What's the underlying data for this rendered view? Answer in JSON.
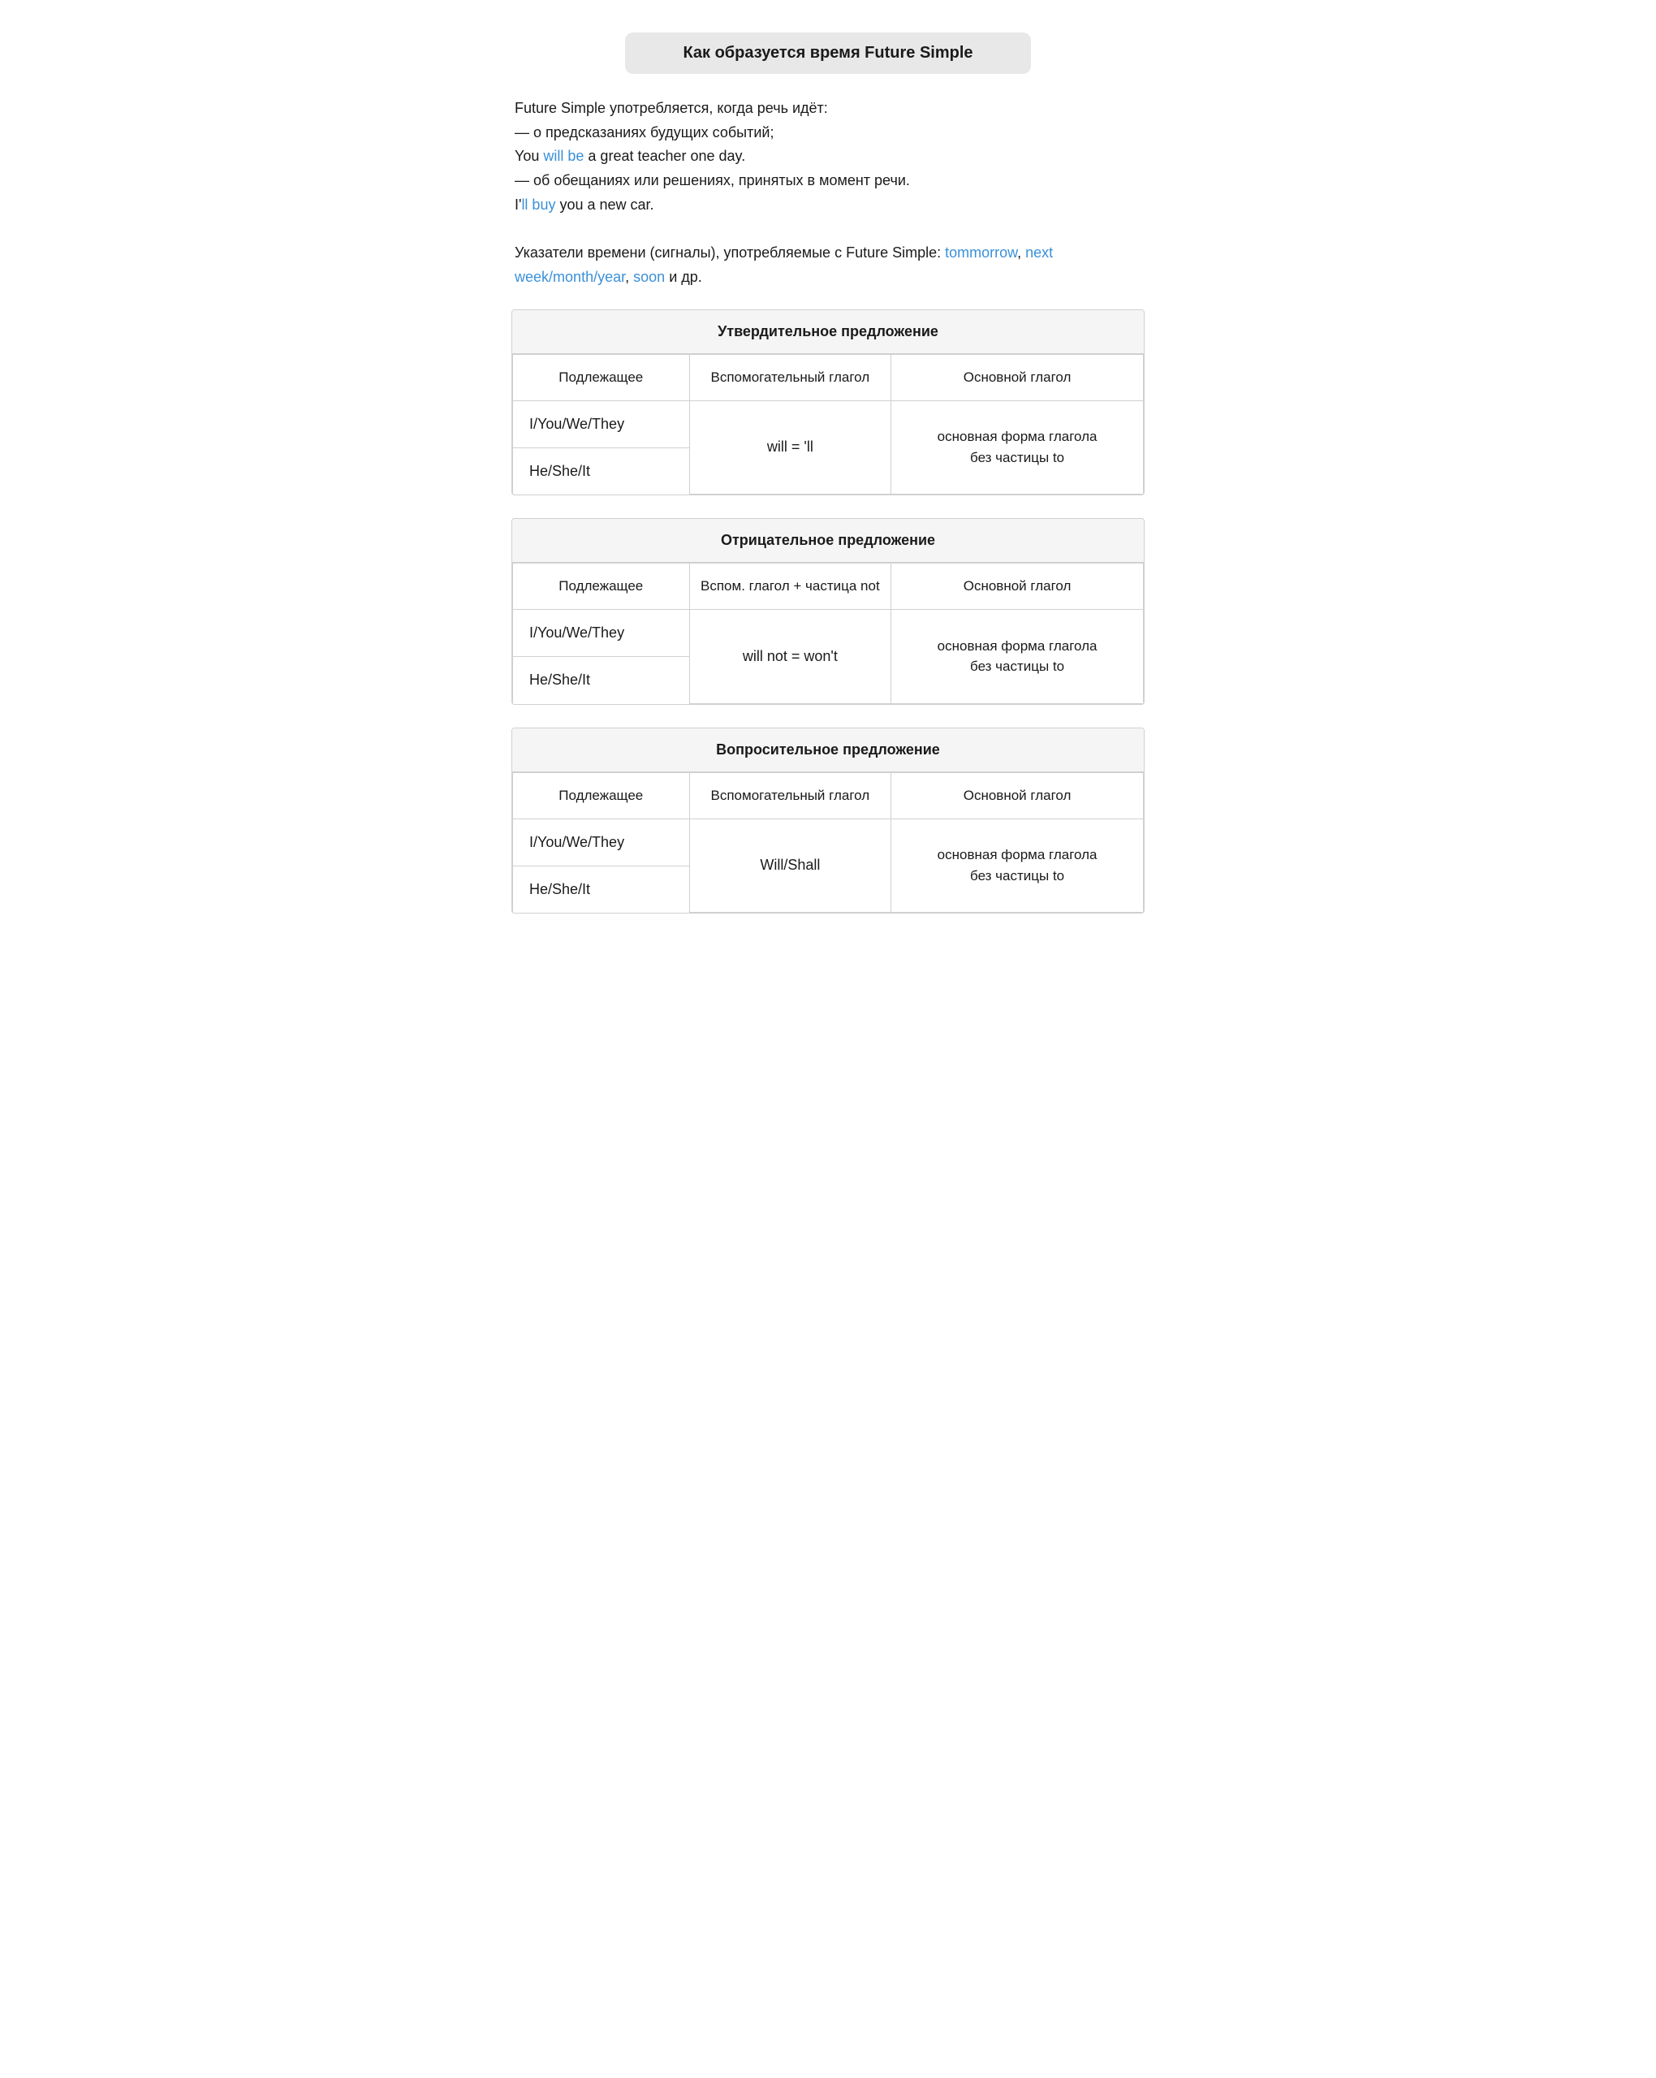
{
  "page": {
    "title": "Как образуется время Future Simple",
    "intro": {
      "line1": "Future Simple употребляется, когда речь идёт:",
      "line2": "— о предсказаниях будущих событий;",
      "line3_prefix": "You ",
      "line3_highlight": "will be",
      "line3_suffix": " a great teacher one day.",
      "line4": "— об обещаниях или решениях, принятых в момент речи.",
      "line5_prefix": "I'",
      "line5_highlight": "ll buy",
      "line5_suffix": " you a new car.",
      "line6_prefix": "Указатели времени (сигналы), употребляемые с Future Simple: ",
      "line6_h1": "tommorrow",
      "line6_sep1": ", ",
      "line6_h2": "next week",
      "line6_sep2": "/",
      "line6_h3": "month",
      "line6_sep3": "/",
      "line6_h4": "year",
      "line6_sep4": ", ",
      "line6_h5": "soon",
      "line6_suffix": " и др."
    },
    "affirmative": {
      "title": "Утвердительное предложение",
      "col1": "Подлежащее",
      "col2": "Вспомогательный глагол",
      "col3": "Основной глагол",
      "pronoun1": "I/You/We/They",
      "pronoun2": "He/She/It",
      "aux_verb": "will = 'll",
      "main_verb_line1": "основная форма глагола",
      "main_verb_line2": "без частицы to"
    },
    "negative": {
      "title": "Отрицательное предложение",
      "col1": "Подлежащее",
      "col2": "Вспом. глагол + частица not",
      "col3": "Основной глагол",
      "pronoun1": "I/You/We/They",
      "pronoun2": "He/She/It",
      "aux_verb": "will not = won't",
      "main_verb_line1": "основная форма глагола",
      "main_verb_line2": "без частицы to"
    },
    "interrogative": {
      "title": "Вопросительное предложение",
      "col1": "Подлежащее",
      "col2": "Вспомогательный глагол",
      "col3": "Основной глагол",
      "pronoun1": "I/You/We/They",
      "pronoun2": "He/She/It",
      "aux_verb": "Will/Shall",
      "main_verb_line1": "основная форма глагола",
      "main_verb_line2": "без частицы to"
    }
  }
}
